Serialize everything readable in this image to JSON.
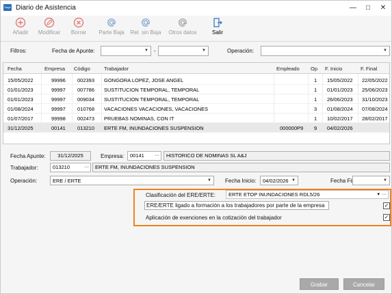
{
  "window": {
    "title": "Diario de Asistencia",
    "app_icon_text": "Sage",
    "min_glyph": "—",
    "max_glyph": "□",
    "close_glyph": "✕"
  },
  "toolbar": {
    "items": [
      {
        "label": "Añadir",
        "icon": "add-circle-icon",
        "enabled": false
      },
      {
        "label": "Modificar",
        "icon": "pencil-circle-icon",
        "enabled": false
      },
      {
        "label": "Borrar",
        "icon": "delete-circle-icon",
        "enabled": false
      },
      {
        "label": "Parte Baja",
        "icon": "at-sign-icon",
        "enabled": false
      },
      {
        "label": "Rel. sin Baja",
        "icon": "at-sign-icon",
        "enabled": false
      },
      {
        "label": "Otros datos",
        "icon": "at-sign-icon",
        "enabled": false
      },
      {
        "label": "Salir",
        "icon": "exit-icon",
        "enabled": true
      }
    ]
  },
  "filters": {
    "label": "Filtros:",
    "fecha_apunte_label": "Fecha de Apunte:",
    "date_separator": "-",
    "operacion_label": "Operación:"
  },
  "grid": {
    "headers": [
      "Fecha",
      "Empresa",
      "Código",
      "Trabajador",
      "Empleado",
      "Op",
      "F. Inicio",
      "F. Final"
    ],
    "rows": [
      [
        "15/05/2022",
        "99996",
        "002393",
        "GONGORA LOPEZ, JOSE ANGEL",
        "",
        "1",
        "15/05/2022",
        "22/05/2022"
      ],
      [
        "01/01/2023",
        "99997",
        "007786",
        "SUSTITUCION TEMPORAL, TEMPORAL",
        "",
        "1",
        "01/01/2023",
        "25/06/2023"
      ],
      [
        "01/01/2023",
        "99997",
        "009034",
        "SUSTITUCION TEMPORAL, TEMPORAL",
        "",
        "1",
        "26/06/2023",
        "31/10/2023"
      ],
      [
        "01/08/2024",
        "99997",
        "010768",
        "VACACIONES VACACIONES, VACACIONES",
        "",
        "3",
        "01/08/2024",
        "07/08/2024"
      ],
      [
        "01/07/2017",
        "99998",
        "002473",
        "PRUEBAS NOMINAS, CON IT",
        "",
        "1",
        "10/02/2017",
        "28/02/2017"
      ],
      [
        "31/12/2025",
        "00141",
        "013210",
        "ERTE FM, INUNDACIONES SUSPENSION",
        "000000P9",
        "9",
        "04/02/2026",
        ""
      ]
    ]
  },
  "form": {
    "fecha_apunte_label": "Fecha Apunte:",
    "fecha_apunte_value": "31/12/2025",
    "empresa_label": "Empresa:",
    "empresa_code": "00141",
    "empresa_name": "HISTORICO DE NOMINAS SL A&J",
    "trabajador_label": "Trabajador:",
    "trabajador_code": "013210",
    "trabajador_name": "ERTE FM, INUNDACIONES SUSPENSION",
    "operacion_label": "Operación:",
    "operacion_value": "ERE / ERTE",
    "fecha_inicio_label": "Fecha Inicio:",
    "fecha_inicio_value": "04/02/2026",
    "fecha_fin_label": "Fecha Fin:",
    "fecha_fin_value": "",
    "clasificacion_label": "Clasificación del ERE/ERTE:",
    "clasificacion_value": "ERTE ETOP INUNDACIONES RDL5/26",
    "check1_label": "ERE/ERTE ligado a formación a los trabajadores por parte de la empresa",
    "check1_checked": true,
    "check2_label": "Aplicación de exenciones en la cotización del trabajador",
    "check2_checked": true,
    "dots": "···",
    "check_glyph": "✓"
  },
  "buttons": {
    "save_label": "Grabar",
    "cancel_label": "Cancelar"
  },
  "colors": {
    "highlight": "#f08020",
    "disabled_icon": "#e07a7a",
    "at_icon": "#7aa0d0",
    "exit_icon": "#3a78c0"
  }
}
